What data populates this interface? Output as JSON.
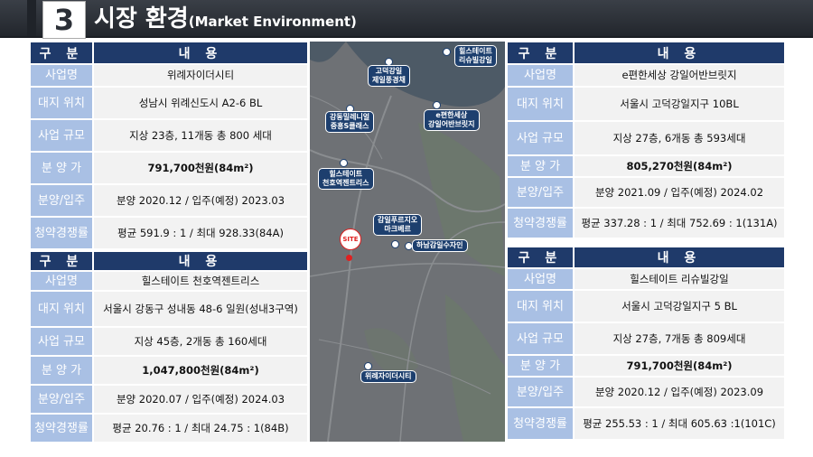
{
  "header": {
    "number": "3",
    "title": "시장 환경",
    "subtitle": "(Market Environment)"
  },
  "col_head": {
    "left": "구 분",
    "right": "내 용"
  },
  "tables": {
    "t1": {
      "rows": [
        {
          "k": "사업명",
          "v": "위례자이더시티"
        },
        {
          "k": "대지 위치",
          "v": "성남시 위례신도시 A2-6 BL"
        },
        {
          "k": "사업 규모",
          "v": "지상 23층, 11개동 총 800 세대"
        },
        {
          "k": "분 양 가",
          "v": "791,700천원(84m²)"
        },
        {
          "k": "분양/입주",
          "v": "분양 2020.12 / 입주(예정) 2023.03"
        },
        {
          "k": "청약경쟁률",
          "v": "평균 591.9 : 1 / 최대 928.33(84A)"
        }
      ]
    },
    "t2": {
      "rows": [
        {
          "k": "사업명",
          "v": "힐스테이트 천호역젠트리스"
        },
        {
          "k": "대지 위치",
          "v": "서울시 강동구 성내동 48-6 일원(성내3구역)"
        },
        {
          "k": "사업 규모",
          "v": "지상 45층, 2개동 총 160세대"
        },
        {
          "k": "분 양 가",
          "v": "1,047,800천원(84m²)"
        },
        {
          "k": "분양/입주",
          "v": "분양 2020.07 / 입주(예정) 2024.03"
        },
        {
          "k": "청약경쟁률",
          "v": "평균 20.76 : 1 / 최대 24.75 : 1(84B)"
        }
      ]
    },
    "t3": {
      "rows": [
        {
          "k": "사업명",
          "v": "e편한세상 강일어반브릿지"
        },
        {
          "k": "대지 위치",
          "v": "서울시 고덕강일지구 10BL"
        },
        {
          "k": "사업 규모",
          "v": "지상 27층, 6개동 총 593세대"
        },
        {
          "k": "분 양 가",
          "v": "805,270천원(84m²)"
        },
        {
          "k": "분양/입주",
          "v": "분양 2021.09 / 입주(예정) 2024.02"
        },
        {
          "k": "청약경쟁률",
          "v": "평균 337.28 : 1 / 최대 752.69 : 1(131A)"
        }
      ]
    },
    "t4": {
      "rows": [
        {
          "k": "사업명",
          "v": "힐스테이트 리슈빌강일"
        },
        {
          "k": "대지 위치",
          "v": "서울시 고덕강일지구 5 BL"
        },
        {
          "k": "사업 규모",
          "v": "지상 27층, 7개동 총 809세대"
        },
        {
          "k": "분 양 가",
          "v": "791,700천원(84m²)"
        },
        {
          "k": "분양/입주",
          "v": "분양 2020.12 / 입주(예정) 2023.09"
        },
        {
          "k": "청약경쟁률",
          "v": "평균 255.53 : 1 / 최대 605.63 :1(101C)"
        }
      ]
    }
  },
  "map": {
    "site_label": "SITE",
    "pins": {
      "p1": "힐스테이트\n리슈빌강일",
      "p2": "고덕강일\n제일풍경채",
      "p3": "강동밀레니얼\n중흥S클래스",
      "p4": "e편한세상\n강일어반브릿지",
      "p5": "힐스테이트\n천호역젠트리스",
      "p6": "감일푸르지오\n마크베르",
      "p7": "하남감일수자인",
      "p8": "위례자이더시티"
    }
  }
}
